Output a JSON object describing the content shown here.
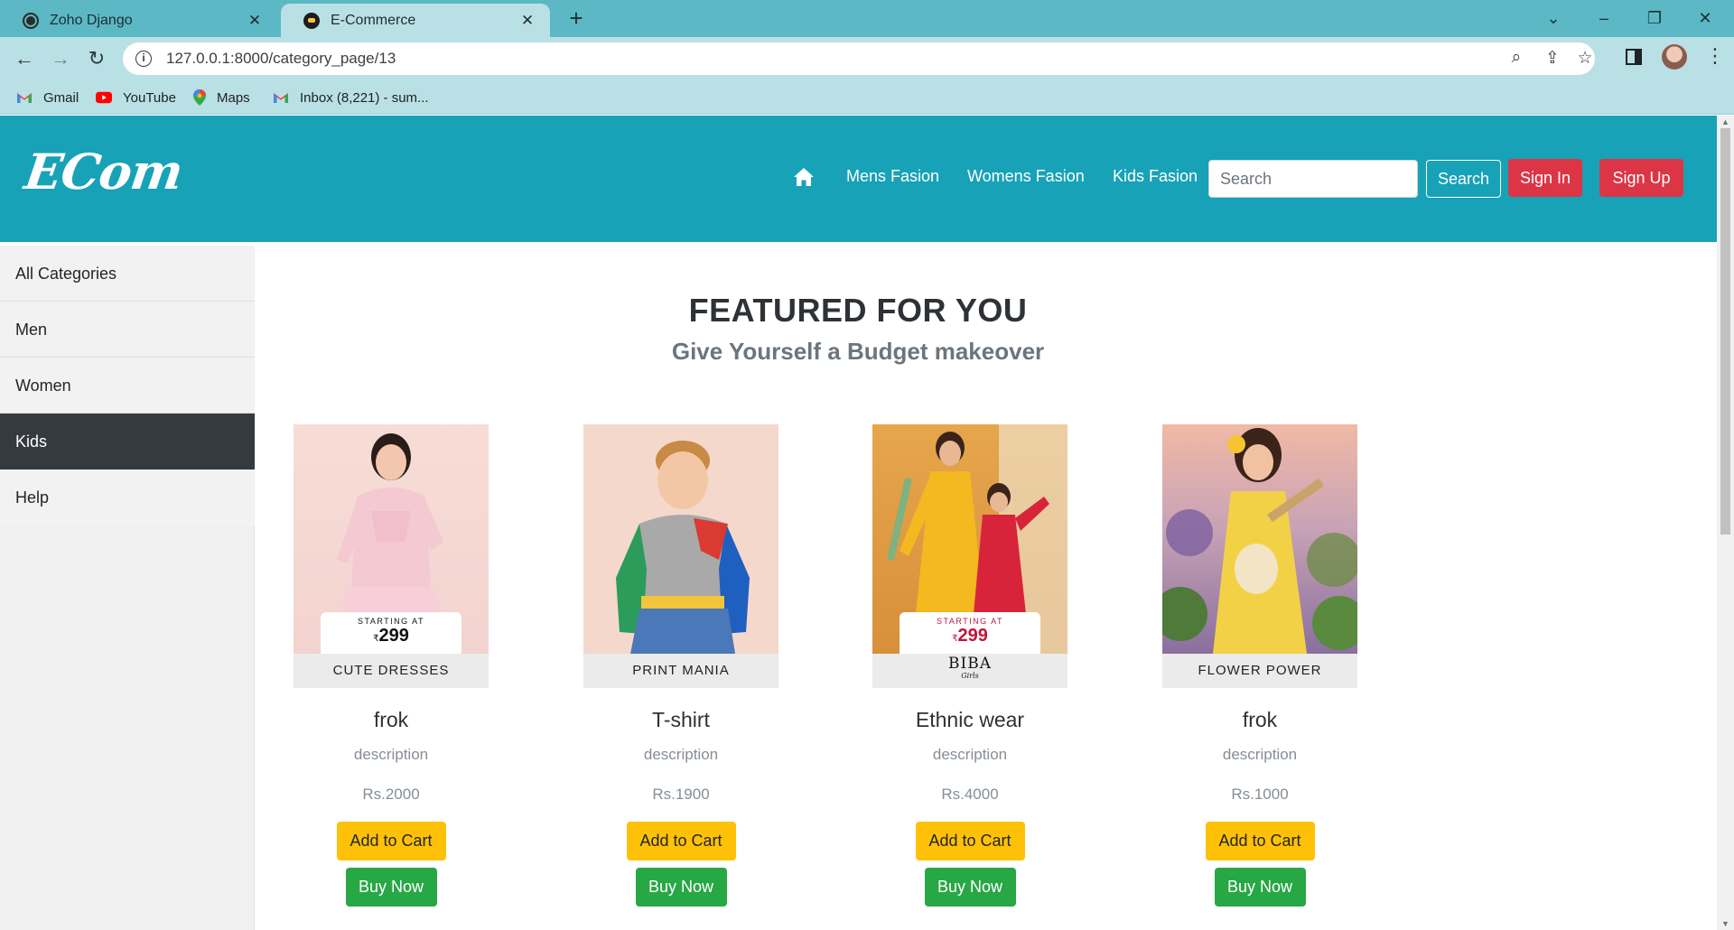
{
  "browser": {
    "tabs": [
      {
        "title": "Zoho Django"
      },
      {
        "title": "E-Commerce"
      }
    ],
    "url": "127.0.0.1:8000/category_page/13",
    "bookmarks": [
      {
        "label": "Gmail"
      },
      {
        "label": "YouTube"
      },
      {
        "label": "Maps"
      },
      {
        "label": "Inbox (8,221) - sum..."
      }
    ]
  },
  "navbar": {
    "brand": "ECom",
    "links": [
      "Mens Fasion",
      "Womens Fasion",
      "Kids Fasion"
    ],
    "search_placeholder": "Search",
    "search_button": "Search",
    "sign_in": "Sign In",
    "sign_up": "Sign Up"
  },
  "sidebar": {
    "items": [
      {
        "label": "All Categories"
      },
      {
        "label": "Men"
      },
      {
        "label": "Women"
      },
      {
        "label": "Kids",
        "active": true
      },
      {
        "label": "Help"
      }
    ]
  },
  "featured": {
    "title": "FEATURED FOR YOU",
    "subtitle": "Give Yourself a Budget makeover"
  },
  "products": [
    {
      "banner": "CUTE DRESSES",
      "tag_top": "STARTING AT",
      "tag_currency": "₹",
      "tag_price": "299",
      "name": "frok",
      "description": "description",
      "price": "Rs.2000",
      "cart_label": "Add to Cart",
      "buy_label": "Buy Now"
    },
    {
      "banner": "PRINT MANIA",
      "name": "T-shirt",
      "description": "description",
      "price": "Rs.1900",
      "cart_label": "Add to Cart",
      "buy_label": "Buy Now"
    },
    {
      "banner_logo": "BIBA",
      "banner_logo_sub": "Girls",
      "tag_top": "STARTING AT",
      "tag_currency": "₹",
      "tag_price": "299",
      "name": "Ethnic wear",
      "description": "description",
      "price": "Rs.4000",
      "cart_label": "Add to Cart",
      "buy_label": "Buy Now"
    },
    {
      "banner": "FLOWER POWER",
      "name": "frok",
      "description": "description",
      "price": "Rs.1000",
      "cart_label": "Add to Cart",
      "buy_label": "Buy Now"
    }
  ],
  "colors": {
    "navbar": "#17a2b8",
    "danger": "#dc3545",
    "warning": "#ffc107",
    "success": "#28a745",
    "sidebar_active": "#343a40"
  }
}
